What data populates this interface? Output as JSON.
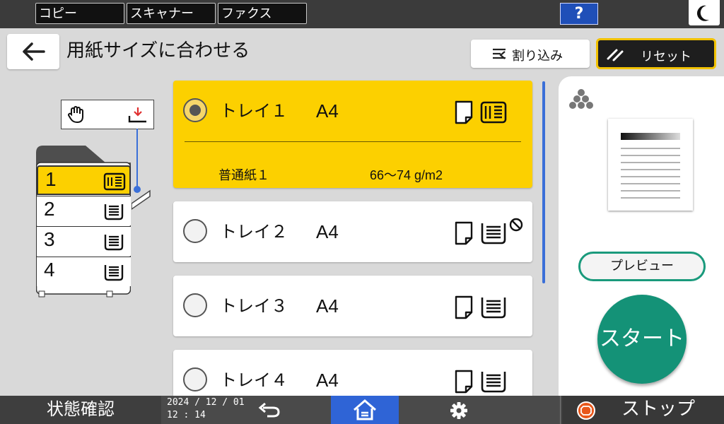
{
  "topbar": {
    "tabs": [
      {
        "label": "コピー"
      },
      {
        "label": "スキャナー"
      },
      {
        "label": "ファクス"
      }
    ],
    "help_label": "?"
  },
  "header": {
    "title": "用紙サイズに合わせる",
    "interrupt_label": "割り込み",
    "reset_label": "リセット"
  },
  "machine": {
    "trays": [
      "1",
      "2",
      "3",
      "4"
    ],
    "selected_tray": "1"
  },
  "trays": [
    {
      "name": "トレイ１",
      "size": "A4",
      "selected": true,
      "paper_type": "普通紙１",
      "weight": "66～74 g/m2"
    },
    {
      "name": "トレイ２",
      "size": "A4",
      "selected": false,
      "unavailable": true
    },
    {
      "name": "トレイ３",
      "size": "A4",
      "selected": false
    },
    {
      "name": "トレイ４",
      "size": "A4",
      "selected": false
    }
  ],
  "right_panel": {
    "preview_label": "プレビュー",
    "start_label": "スタート"
  },
  "bottombar": {
    "status_label": "状態確認",
    "date": "2024 / 12 / 01",
    "time": "12 : 14",
    "stop_label": "ストップ"
  },
  "colors": {
    "selected": "#fcd000",
    "accent_blue": "#2f64d6",
    "start_green": "#149277"
  }
}
